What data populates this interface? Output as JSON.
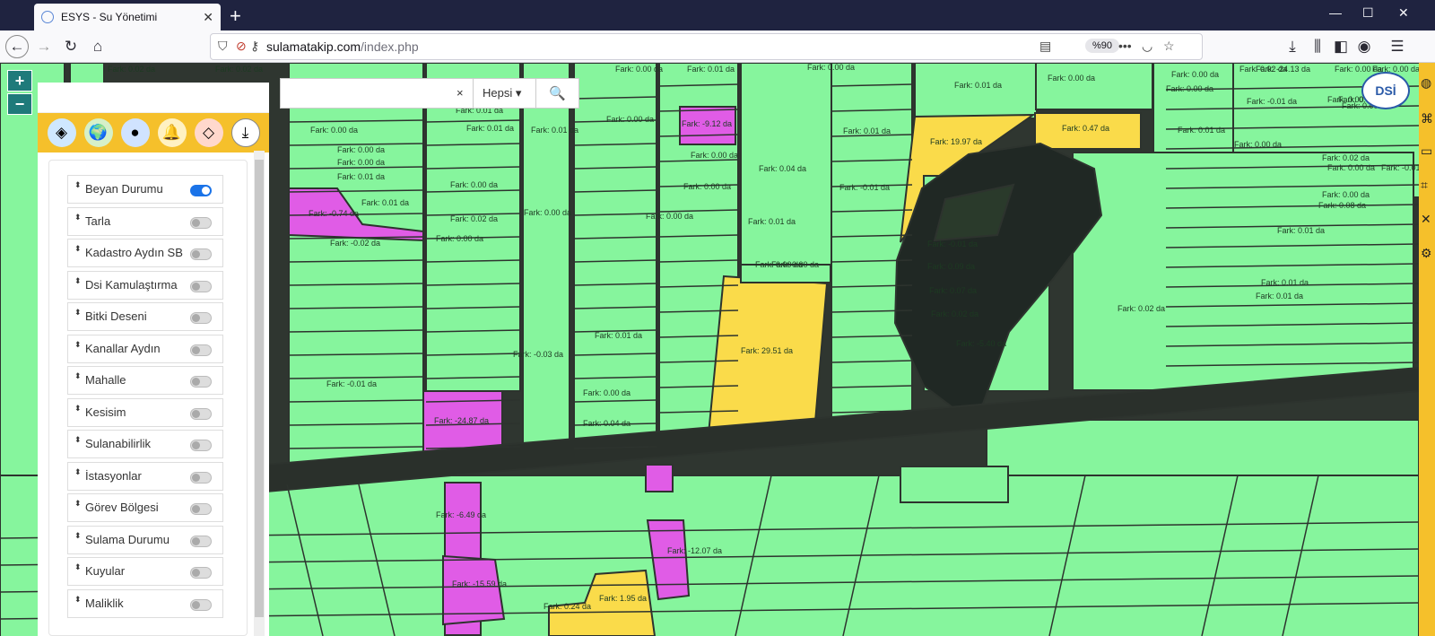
{
  "browser": {
    "tab_title": "ESYS - Su Yönetimi",
    "url_domain": "sulamatakip.com",
    "url_path": "/index.php",
    "zoom": "%90"
  },
  "map": {
    "zoom_in": "+",
    "zoom_out": "−",
    "logo": "DSİ",
    "parcel_labels": [
      "Fark: 0.02 da",
      "Fark: 0.02 da",
      "Fark: 0.00 da",
      "Fark: 0.01 da",
      "Fark: 0.00 da",
      "Fark: -24.13 da",
      "Fark: 0.00 da",
      "Fark: 0.01 da",
      "Fark: 0.00 da",
      "Fark: -0.01 da",
      "Fark: 0.00 da",
      "Fark: 0.00 da",
      "Fark: 0.01 da",
      "Fark: 0.00 da",
      "Fark: 0.01 da",
      "Fark: 0.01 da",
      "Fark: 0.00 da",
      "Fark: -9.12 da",
      "Fark: 0.00 da",
      "Fark: 0.00 da",
      "Fark: 0.01 da",
      "Fark: 0.00 da",
      "Fark: 0.00 da",
      "Fark: 0.00 da",
      "Fark: 0.00 da",
      "Fark: 0.01 da",
      "Fark: 0.04 da",
      "Fark: 19.97 da",
      "Fark: 0.47 da",
      "Fark: 0.01 da",
      "Fark: 0.00 da",
      "Fark: -0.74 da",
      "Fark: 0.01 da",
      "Fark: -0.02 da",
      "Fark: 0.02 da",
      "Fark: 0.00 da",
      "Fark: -0.01 da",
      "Fark: 0.01 da",
      "Fark: 0.00 da",
      "Fark: 0.00 da",
      "Fark: 29.51 da",
      "Fark: -0.01 da",
      "Fark: 0.09 da",
      "Fark: 0.07 da",
      "Fark: 0.02 da",
      "Fark: -5.40 da",
      "Fark: -0.01 da",
      "Fark: -0.03 da",
      "Fark: 0.01 da",
      "Fark: -24.87 da",
      "Fark: 0.00 da",
      "Fark: 0.04 da",
      "Fark: 0.00 da",
      "Fark: 0.00 da",
      "Fark: 0.00 da",
      "Fark: -6.49 da",
      "Fark: -15.59 da",
      "Fark: -12.07 da",
      "Fark: 1.95 da",
      "Fark: 0.24 da",
      "Fark: 0.02 da",
      "Fark: 0.00 da",
      "Fark: -0.01 da",
      "Fark: 0.02 da",
      "Fark: 0.01 da",
      "Fark: 0.00 da",
      "Fark: 0.01 da",
      "Fark: 0.00 da",
      "Fark: 0.02 da",
      "Fark: 0.01 da",
      "Fark: 0.08 da",
      "Fark: 0.00 da"
    ]
  },
  "colors": {
    "parcel_ok": "#86f59d",
    "parcel_deficit": "#e05ce6",
    "parcel_surplus": "#fadb4a",
    "road": "#2f3630",
    "toolbar": "#f5c02b"
  },
  "search": {
    "placeholder": "",
    "value": "",
    "clear": "×",
    "filter": "Hepsi ▾"
  },
  "panel": {
    "tools": [
      "layers-icon",
      "earth-icon",
      "globe-icon",
      "bell-icon",
      "location-icon",
      "download-icon"
    ],
    "layers": [
      {
        "label": "Beyan Durumu",
        "on": true
      },
      {
        "label": "Tarla",
        "on": false
      },
      {
        "label": "Kadastro Aydın SB",
        "on": false
      },
      {
        "label": "Dsi Kamulaştırma",
        "on": false
      },
      {
        "label": "Bitki Deseni",
        "on": false
      },
      {
        "label": "Kanallar Aydın",
        "on": false
      },
      {
        "label": "Mahalle",
        "on": false
      },
      {
        "label": "Kesisim",
        "on": false
      },
      {
        "label": "Sulanabilirlik",
        "on": false
      },
      {
        "label": "İstasyonlar",
        "on": false
      },
      {
        "label": "Görev Bölgesi",
        "on": false
      },
      {
        "label": "Sulama Durumu",
        "on": false
      },
      {
        "label": "Kuyular",
        "on": false
      },
      {
        "label": "Maliklik",
        "on": false
      }
    ]
  }
}
